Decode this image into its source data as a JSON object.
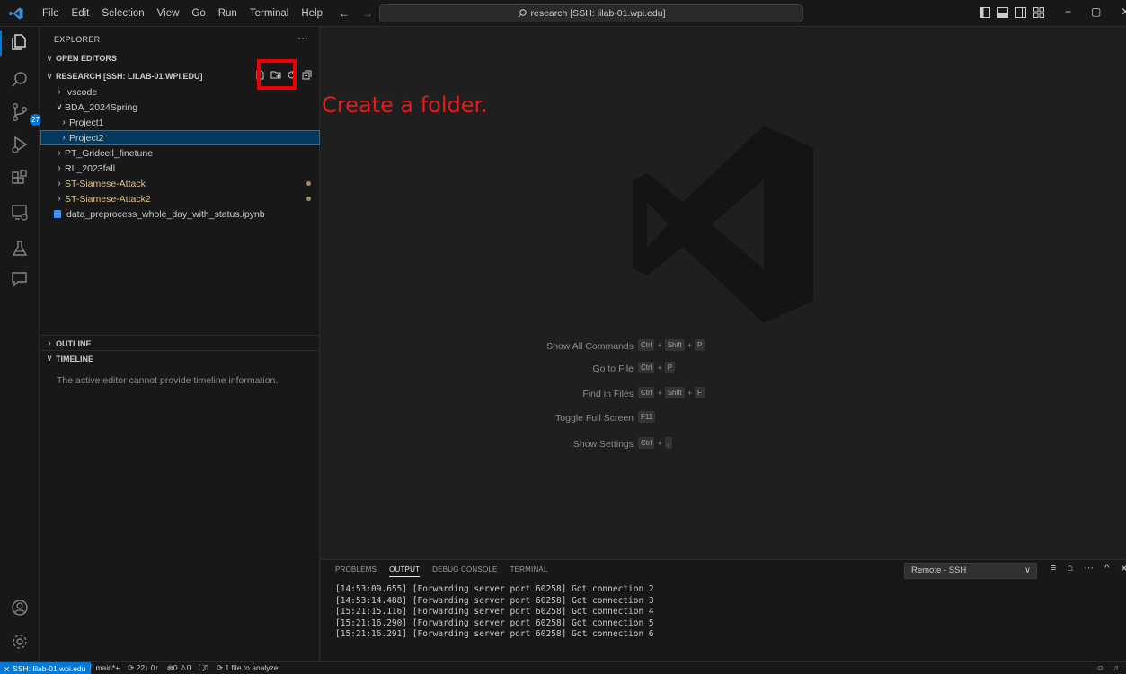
{
  "titlebar": {
    "menu": [
      "File",
      "Edit",
      "Selection",
      "View",
      "Go",
      "Run",
      "Terminal",
      "Help"
    ],
    "command_center": "research [SSH: lilab-01.wpi.edu]",
    "window_controls": [
      "−",
      "▢",
      "✕"
    ]
  },
  "activity_bar": {
    "items": [
      "explorer-icon",
      "search-icon",
      "source-control-icon",
      "run-debug-icon",
      "extensions-icon",
      "remote-explorer-icon",
      "testing-icon",
      "chat-icon"
    ],
    "scm_badge": "27",
    "bottom": [
      "accounts-icon",
      "manage-gear-icon"
    ]
  },
  "sidebar": {
    "title": "EXPLORER",
    "more": "···",
    "open_editors": "OPEN EDITORS",
    "workspace": "RESEARCH [SSH: LILAB-01.WPI.EDU]",
    "tree": [
      {
        "label": ".vscode"
      },
      {
        "label": "BDA_2024Spring"
      },
      {
        "label": "Project1"
      },
      {
        "label": "Project2"
      },
      {
        "label": "PT_Gridcell_finetune"
      },
      {
        "label": "RL_2023fall"
      },
      {
        "label": "ST-Siamese-Attack"
      },
      {
        "label": "ST-Siamese-Attack2"
      },
      {
        "label": "data_preprocess_whole_day_with_status.ipynb"
      }
    ],
    "outline": "OUTLINE",
    "timeline": "TIMELINE",
    "timeline_message": "The active editor cannot provide timeline information."
  },
  "annotation": {
    "text": "Create a folder.",
    "color": "#e81a1a"
  },
  "editor": {
    "shortcuts": [
      {
        "label": "Show All Commands",
        "keys": [
          "Ctrl",
          "Shift",
          "P"
        ]
      },
      {
        "label": "Go to File",
        "keys": [
          "Ctrl",
          "P"
        ]
      },
      {
        "label": "Find in Files",
        "keys": [
          "Ctrl",
          "Shift",
          "F"
        ]
      },
      {
        "label": "Toggle Full Screen",
        "keys": [
          "F11"
        ]
      },
      {
        "label": "Show Settings",
        "keys": [
          "Ctrl",
          ","
        ]
      }
    ]
  },
  "panel": {
    "tabs": [
      "PROBLEMS",
      "OUTPUT",
      "DEBUG CONSOLE",
      "TERMINAL"
    ],
    "active_tab": "OUTPUT",
    "output_channel": "Remote - SSH",
    "log": [
      "[14:53:09.655] [Forwarding server port 60258] Got connection 2",
      "[14:53:14.488] [Forwarding server port 60258] Got connection 3",
      "[15:21:15.116] [Forwarding server port 60258] Got connection 4",
      "[15:21:16.290] [Forwarding server port 60258] Got connection 5",
      "[15:21:16.291] [Forwarding server port 60258] Got connection 6"
    ]
  },
  "statusbar": {
    "remote": "SSH: lilab-01.wpi.edu",
    "branch": "main*+",
    "sync": "22↓ 0↑",
    "errors": "0",
    "warnings": "0",
    "ports": "0",
    "analyze": "1 file to analyze"
  },
  "colors": {
    "accent": "#0078d4",
    "selection": "#04395e",
    "modified": "#e2c08d"
  }
}
